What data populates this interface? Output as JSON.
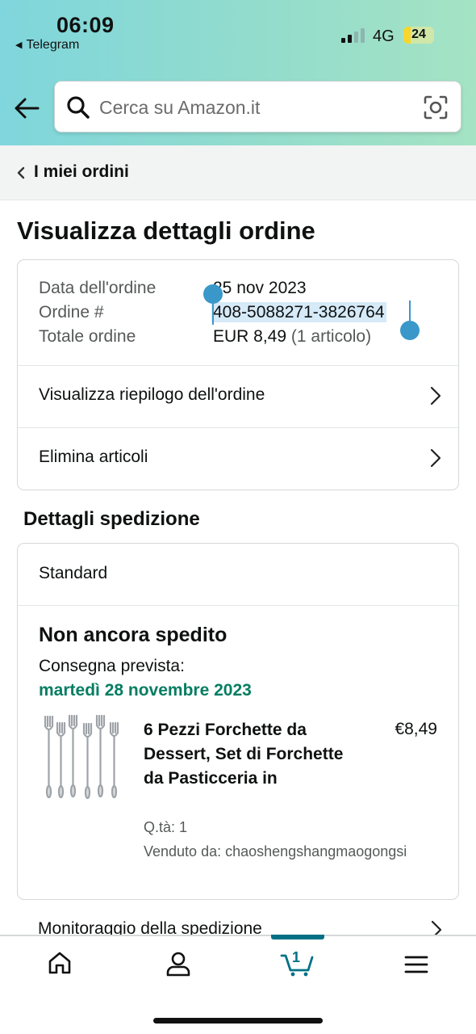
{
  "status_bar": {
    "time": "06:09",
    "back_app": "Telegram",
    "network": "4G",
    "battery": "24",
    "battery_level": 0.24
  },
  "search": {
    "placeholder": "Cerca su Amazon.it"
  },
  "breadcrumb": {
    "label": "I miei ordini"
  },
  "page": {
    "title": "Visualizza dettagli ordine"
  },
  "order": {
    "date_label": "Data dell'ordine",
    "date_value": "25 nov 2023",
    "number_label": "Ordine #",
    "number_value": "408-5088271-3826764",
    "total_label": "Totale ordine",
    "total_value": "EUR 8,49",
    "total_items": "(1 articolo)",
    "summary_link": "Visualizza riepilogo dell'ordine",
    "delete_link": "Elimina articoli"
  },
  "shipping": {
    "section_title": "Dettagli spedizione",
    "method": "Standard",
    "status": "Non ancora spedito",
    "delivery_label": "Consegna prevista:",
    "delivery_date": "martedì 28 novembre 2023",
    "product": {
      "title": "6 Pezzi Forchette da Dessert, Set di Forchette da Pasticceria in",
      "price": "€8,49",
      "quantity": "Q.tà: 1",
      "seller": "Venduto da: chaoshengshangmaogongsi"
    },
    "tracking_link": "Monitoraggio della spedizione"
  },
  "tabbar": {
    "cart_count": "1",
    "items": [
      "home-icon",
      "account-icon",
      "cart-icon",
      "menu-icon"
    ]
  },
  "colors": {
    "header_gradient_start": "#7fd6dc",
    "header_gradient_end": "#a5e3c4",
    "delivery_green": "#067d62",
    "cart_teal": "#007185",
    "selection_blue": "#3a97c9"
  }
}
